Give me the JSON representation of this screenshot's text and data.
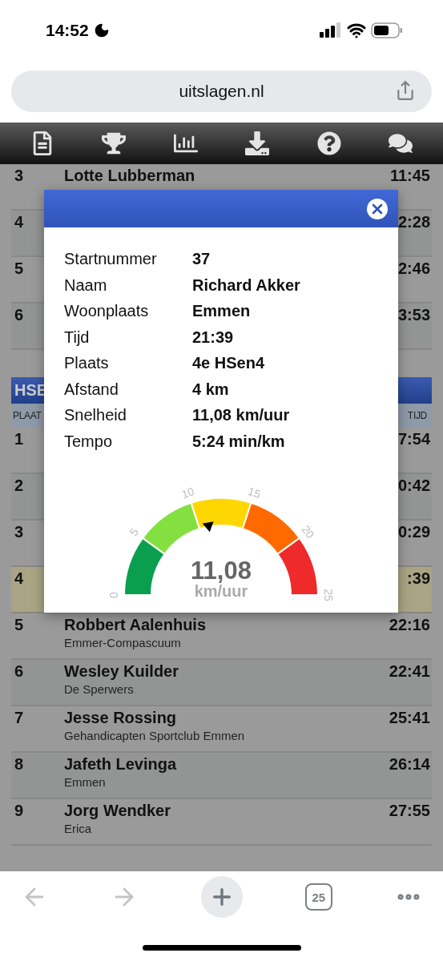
{
  "status_bar": {
    "time": "14:52"
  },
  "address_bar": {
    "url": "uitslagen.nl"
  },
  "results": {
    "top_rows": [
      {
        "place": "3",
        "name": "Lotte Lubberman",
        "time": "11:45"
      },
      {
        "place": "4",
        "time": "2:28"
      },
      {
        "place": "5",
        "time": "2:46"
      },
      {
        "place": "6",
        "time": "3:53"
      }
    ],
    "category": {
      "title": "HSE",
      "columns": [
        "PLAAT",
        "TIJD"
      ]
    },
    "rows": [
      {
        "place": "1",
        "time": "7:54",
        "selected": false
      },
      {
        "place": "2",
        "time": "0:42",
        "selected": false
      },
      {
        "place": "3",
        "time": "0:29",
        "selected": false
      },
      {
        "place": "4",
        "time": ":39",
        "selected": true
      },
      {
        "place": "5",
        "name": "Robbert Aalenhuis",
        "club": "Emmer-Compascuum",
        "time": "22:16",
        "selected": false
      },
      {
        "place": "6",
        "name": "Wesley Kuilder",
        "club": "De Sperwers",
        "time": "22:41",
        "selected": false
      },
      {
        "place": "7",
        "name": "Jesse Rossing",
        "club": "Gehandicapten Sportclub Emmen",
        "time": "25:41",
        "selected": false
      },
      {
        "place": "8",
        "name": "Jafeth Levinga",
        "club": "Emmen",
        "time": "26:14",
        "selected": false
      },
      {
        "place": "9",
        "name": "Jorg Wendker",
        "club": "Erica",
        "time": "27:55",
        "selected": false
      }
    ]
  },
  "modal": {
    "details": [
      {
        "label": "Startnummer",
        "value": "37"
      },
      {
        "label": "Naam",
        "value": "Richard Akker"
      },
      {
        "label": "Woonplaats",
        "value": "Emmen"
      },
      {
        "label": "Tijd",
        "value": "21:39"
      },
      {
        "label": "Plaats",
        "value": "4e HSen4"
      },
      {
        "label": "Afstand",
        "value": "4 km"
      },
      {
        "label": "Snelheid",
        "value": "11,08 km/uur"
      },
      {
        "label": "Tempo",
        "value": "5:24 min/km"
      }
    ],
    "gauge": {
      "reading": "11,08",
      "unit": "km/uur",
      "ticks": [
        "0",
        "5",
        "10",
        "15",
        "20",
        "25"
      ],
      "segments": [
        {
          "color": "#0a9f4f"
        },
        {
          "color": "#84e040"
        },
        {
          "color": "#ffd700"
        },
        {
          "color": "#ff6a00"
        },
        {
          "color": "#ee2a2a"
        }
      ]
    }
  },
  "tab_count": "25"
}
